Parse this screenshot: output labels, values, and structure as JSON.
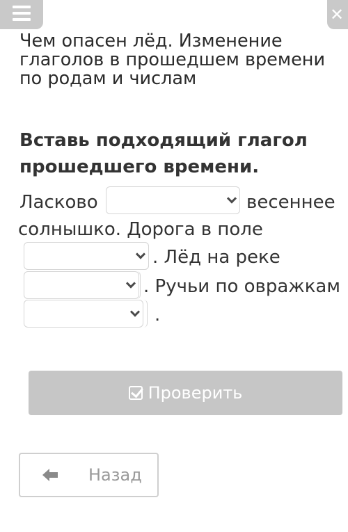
{
  "header": {
    "menu_icon": "hamburger-menu-icon",
    "close_icon": "close-icon"
  },
  "lesson": {
    "title_line1": "Чем опасен лёд. Изменение",
    "title_line2": "глаголов в прошедшем времени",
    "title_line3": "по родам и числам"
  },
  "task": {
    "heading_line1": "Вставь подходящий глагол",
    "heading_line2": "прошедшего времени."
  },
  "exercise": {
    "text_1": "Ласково",
    "text_2": "весеннее",
    "text_3": "солнышко. Дорога в поле",
    "text_4": ". Лёд на реке",
    "text_5": ". Ручьи по овражкам",
    "text_6": ".",
    "dropdowns": [
      {
        "value": ""
      },
      {
        "value": ""
      },
      {
        "value": ""
      },
      {
        "value": ""
      }
    ]
  },
  "buttons": {
    "check_label": "Проверить",
    "back_label": "Назад"
  },
  "colors": {
    "disabled_button": "#c6c6c6",
    "text": "#333333",
    "border": "#d6d6d6"
  }
}
